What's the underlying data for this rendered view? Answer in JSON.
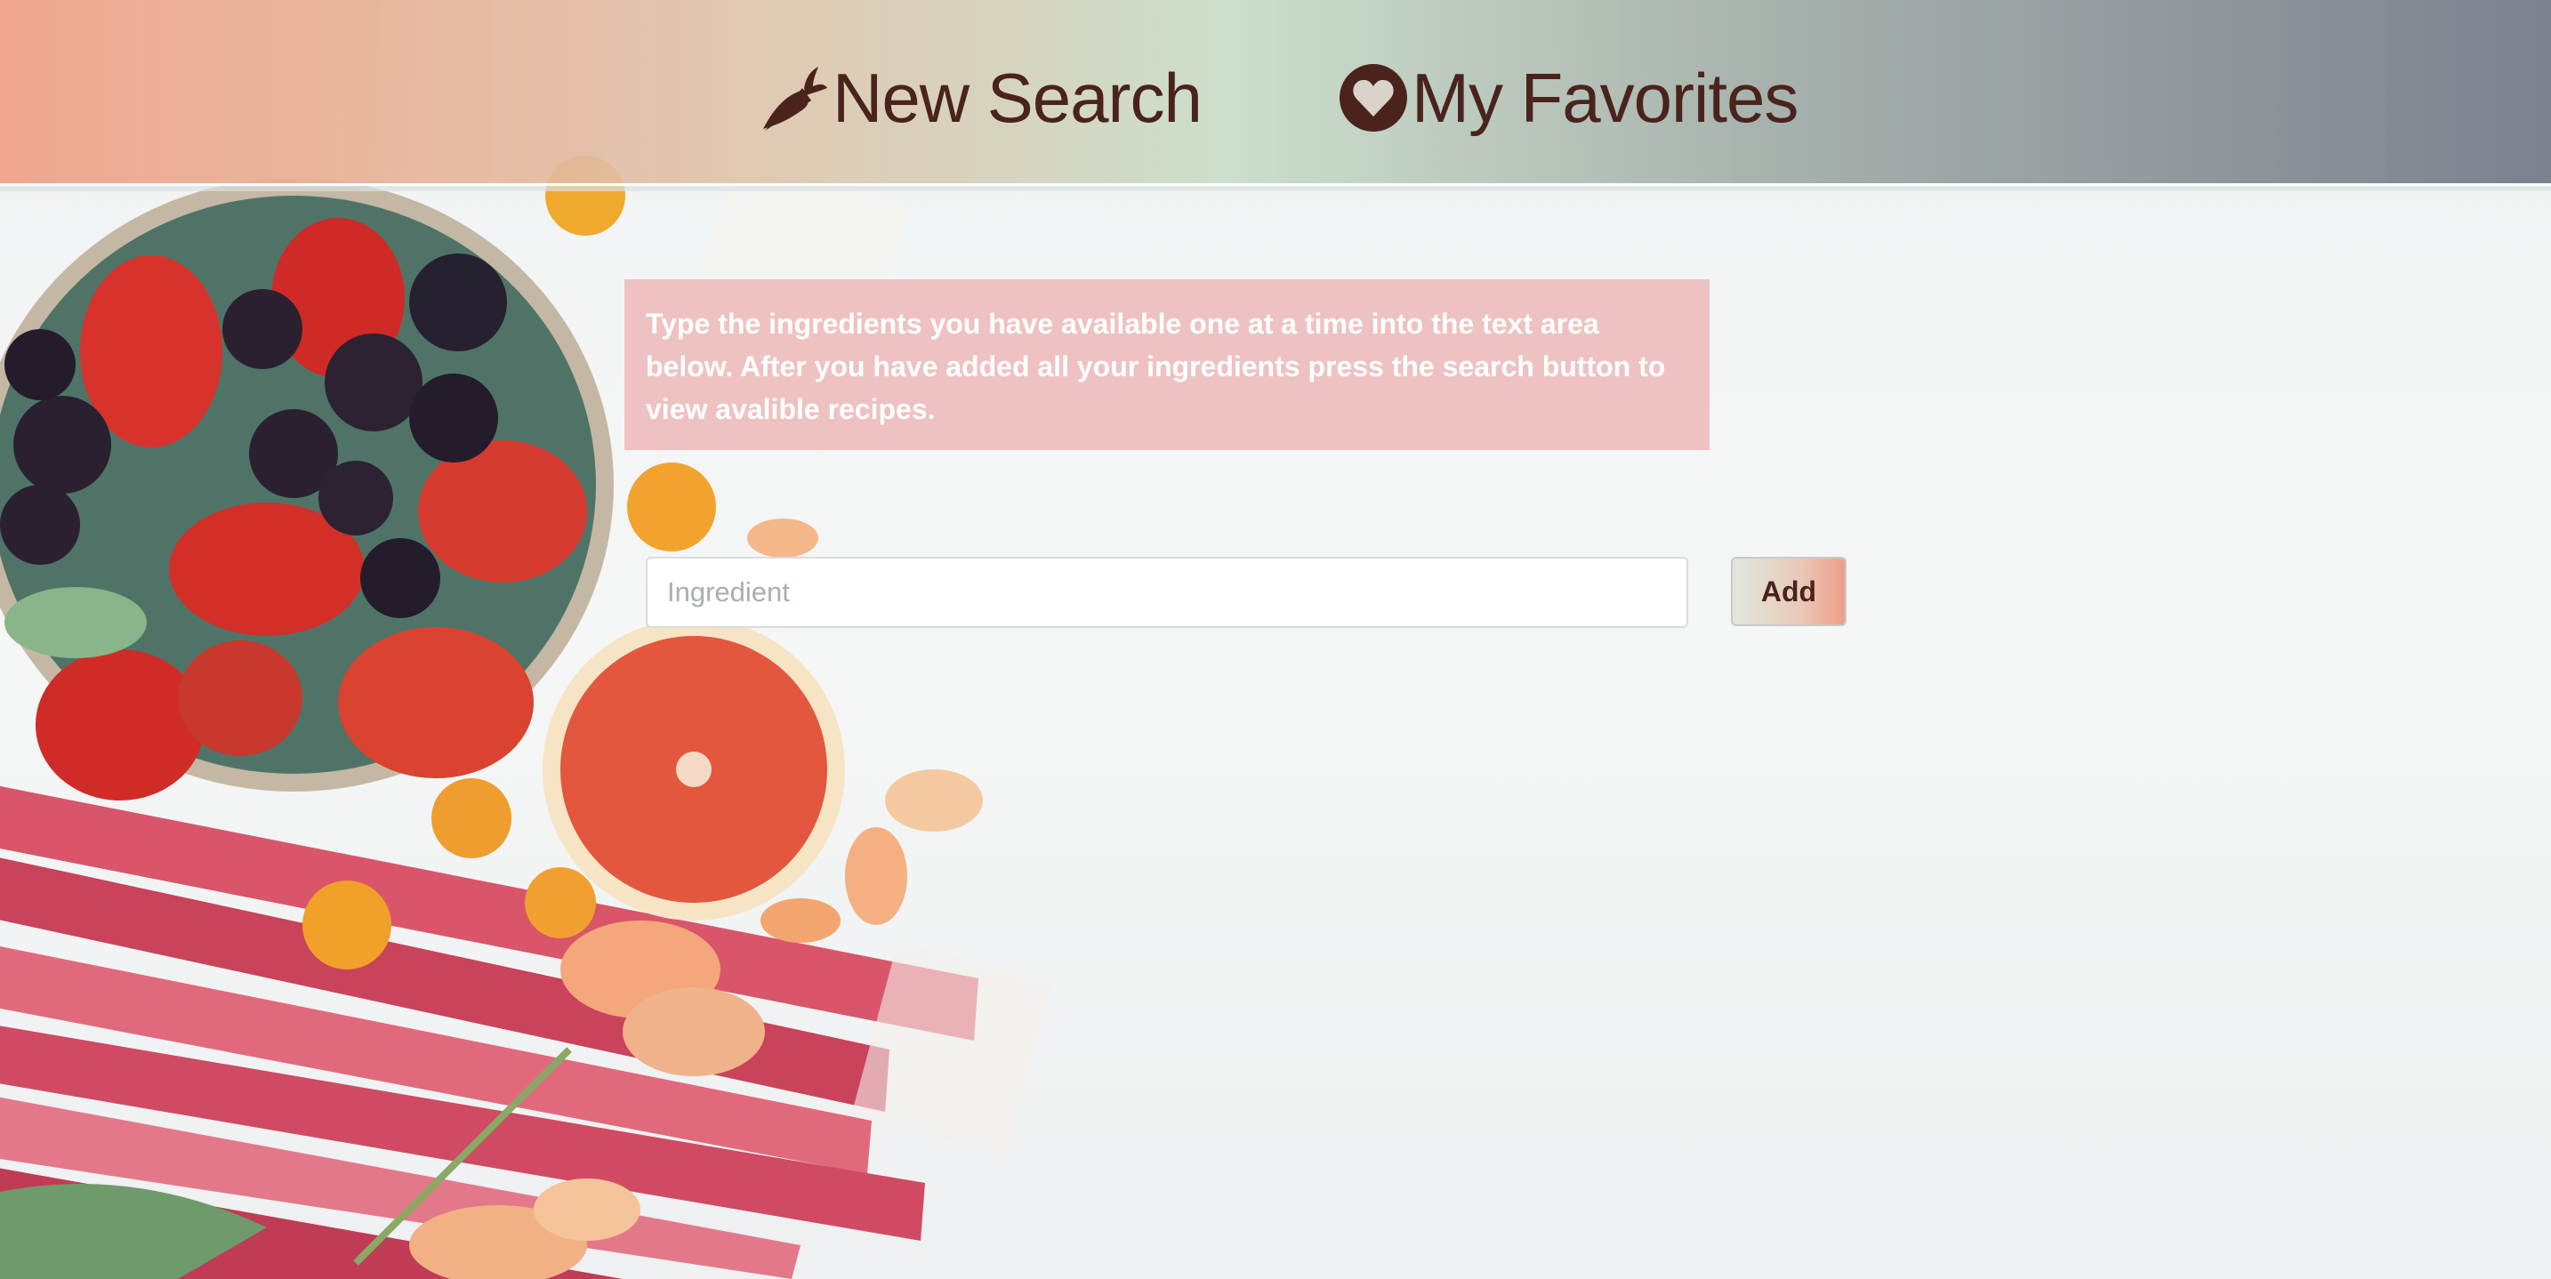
{
  "nav": {
    "new_search": {
      "label": "New Search",
      "icon": "carrot-icon"
    },
    "favorites": {
      "label": "My Favorites",
      "icon": "heart-circle-icon"
    }
  },
  "instructions": {
    "text": "Type the ingredients you have available one at a time into the text area below. After you have added all your ingredients press the search button to view avalible recipes."
  },
  "form": {
    "ingredient_placeholder": "Ingredient",
    "ingredient_value": "",
    "add_label": "Add"
  },
  "colors": {
    "text_brown": "#4a231d",
    "instructions_bg": "#ecb8b8",
    "header_left": "#f0a087",
    "header_mid": "#c8dcc8",
    "header_right": "#767a88"
  }
}
